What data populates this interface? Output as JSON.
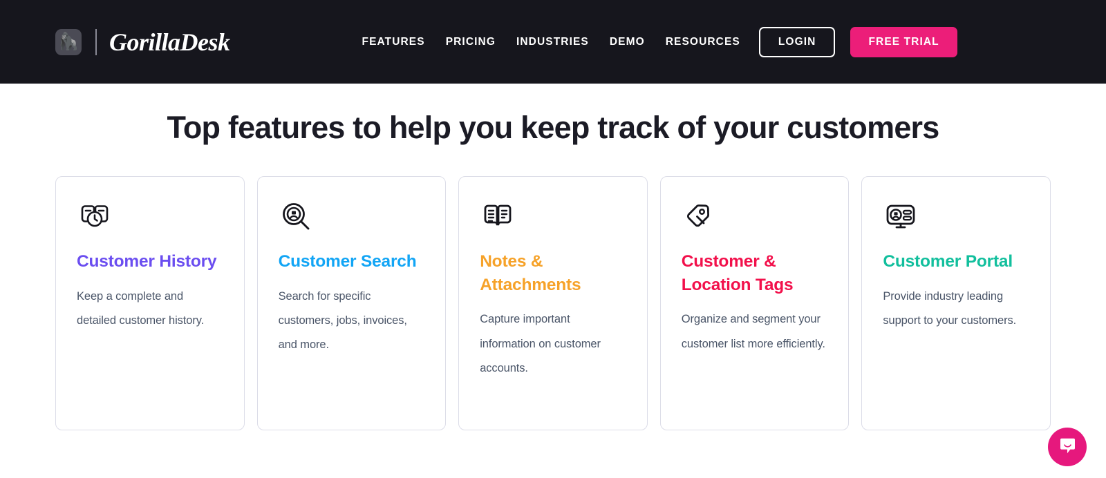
{
  "header": {
    "brand": {
      "logo_icon": "gorilla-avatar-icon",
      "logo_glyph": "🦍",
      "name": "GorillaDesk"
    },
    "nav": [
      {
        "label": "FEATURES"
      },
      {
        "label": "PRICING"
      },
      {
        "label": "INDUSTRIES"
      },
      {
        "label": "DEMO"
      },
      {
        "label": "RESOURCES"
      }
    ],
    "login_label": "LOGIN",
    "trial_label": "FREE TRIAL",
    "background_color": "#16161d",
    "trial_color": "#ec1e79"
  },
  "main": {
    "section_title": "Top features to help you keep track of your customers",
    "cards": [
      {
        "icon": "customer-history-icon",
        "title": "Customer History",
        "description": "Keep a complete and detailed customer history.",
        "color": "#6b4ef0"
      },
      {
        "icon": "customer-search-icon",
        "title": "Customer Search",
        "description": "Search for specific customers, jobs, invoices, and more.",
        "color": "#12a5f5"
      },
      {
        "icon": "notes-attachments-icon",
        "title": "Notes & Attachments",
        "description": "Capture important information on customer accounts.",
        "color": "#f6a229"
      },
      {
        "icon": "location-tags-icon",
        "title": "Customer & Location Tags",
        "description": "Organize and segment your customer list more efficiently.",
        "color": "#f2104b"
      },
      {
        "icon": "customer-portal-icon",
        "title": "Customer Portal",
        "description": "Provide industry leading support to your customers.",
        "color": "#12bf9d"
      }
    ]
  },
  "chat": {
    "icon": "chat-bubble-icon",
    "color": "#e6187d"
  }
}
